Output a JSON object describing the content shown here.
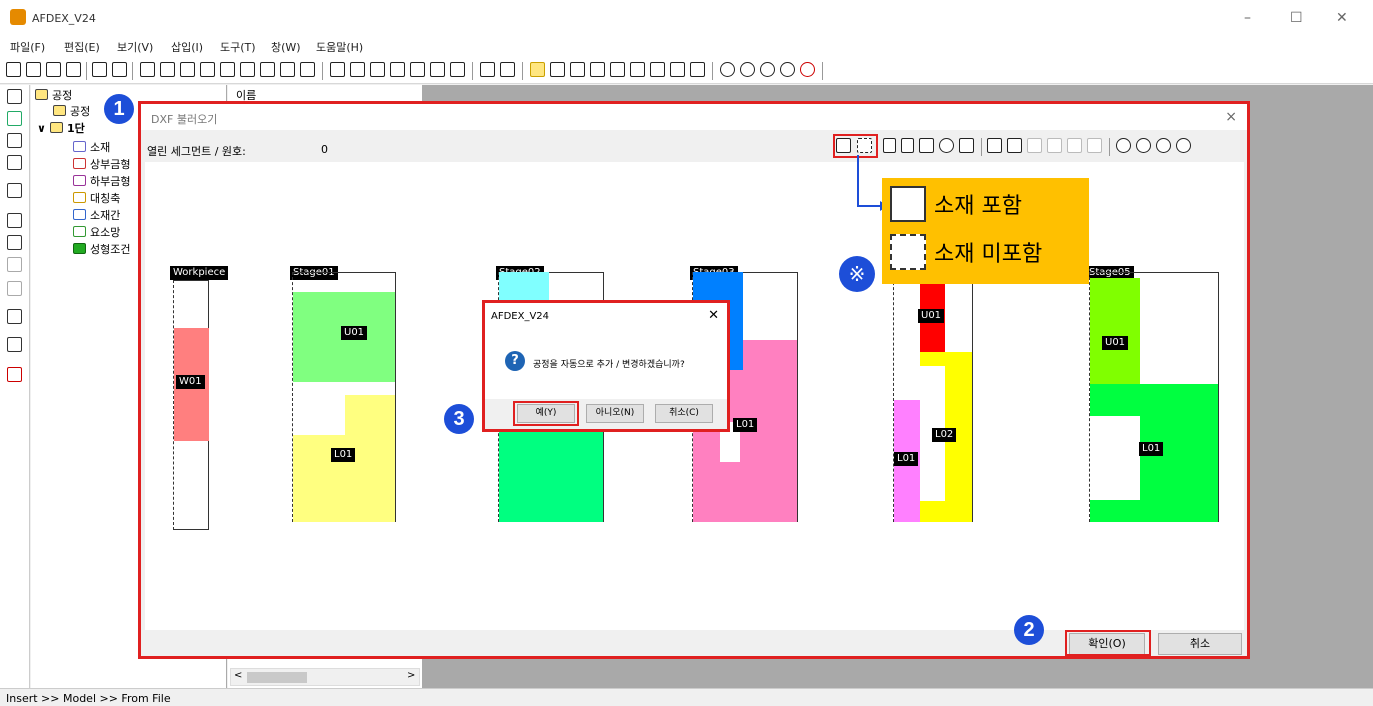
{
  "app": {
    "title": "AFDEX_V24",
    "minimize": "–",
    "maximize": "☐",
    "close": "✕"
  },
  "menu": [
    "파일(F)",
    "편집(E)",
    "보기(V)",
    "삽입(I)",
    "도구(T)",
    "창(W)",
    "도움말(H)"
  ],
  "tree": {
    "root": "공정",
    "items": [
      "공정",
      "1단",
      "소재",
      "상부금형",
      "하부금형",
      "대칭축",
      "소재간",
      "요소망",
      "성형조건"
    ]
  },
  "list_header": "이름",
  "status_text": "Insert >> Model >> From File",
  "dxf_dialog": {
    "title": "DXF 불러오기",
    "close": "×",
    "segment_label": "열린 세그먼트 / 원호:",
    "segment_value": "0",
    "ok_button": "확인(O)",
    "cancel_button": "취소"
  },
  "stages": [
    {
      "label": "Workpiece",
      "parts": [
        "W01"
      ]
    },
    {
      "label": "Stage01",
      "parts": [
        "U01",
        "L01"
      ]
    },
    {
      "label": "Stage02",
      "parts": []
    },
    {
      "label": "Stage03",
      "parts": [
        "L01"
      ]
    },
    {
      "label": "",
      "parts": [
        "U01",
        "L02",
        "L01"
      ]
    },
    {
      "label": "Stage05",
      "parts": [
        "U01",
        "L01"
      ]
    }
  ],
  "confirm_dialog": {
    "title": "AFDEX_V24",
    "close": "✕",
    "icon": "?",
    "message": "공정을 자동으로 추가 / 변경하겠습니까?",
    "yes": "예(Y)",
    "no": "아니오(N)",
    "cancel": "취소(C)"
  },
  "annotations": {
    "step1": "1",
    "step2": "2",
    "step3": "3",
    "ref_mark": "※",
    "legend_include": "소재 포함",
    "legend_exclude": "소재 미포함"
  },
  "colors": {
    "accent_red": "#e02020",
    "annotation_blue": "#1d4ed8",
    "legend_bg": "#ffc000",
    "workpiece": "#ff7f7f",
    "green_light": "#80ff80",
    "yellow_light": "#ffff80",
    "cyan": "#80ffff",
    "green": "#00ff80",
    "blue": "#0080ff",
    "pink": "#ff80c0",
    "red": "#ff0000",
    "yellow": "#ffff00",
    "magenta": "#ff80ff",
    "lime": "#80ff00",
    "green_bright": "#00ff40"
  }
}
